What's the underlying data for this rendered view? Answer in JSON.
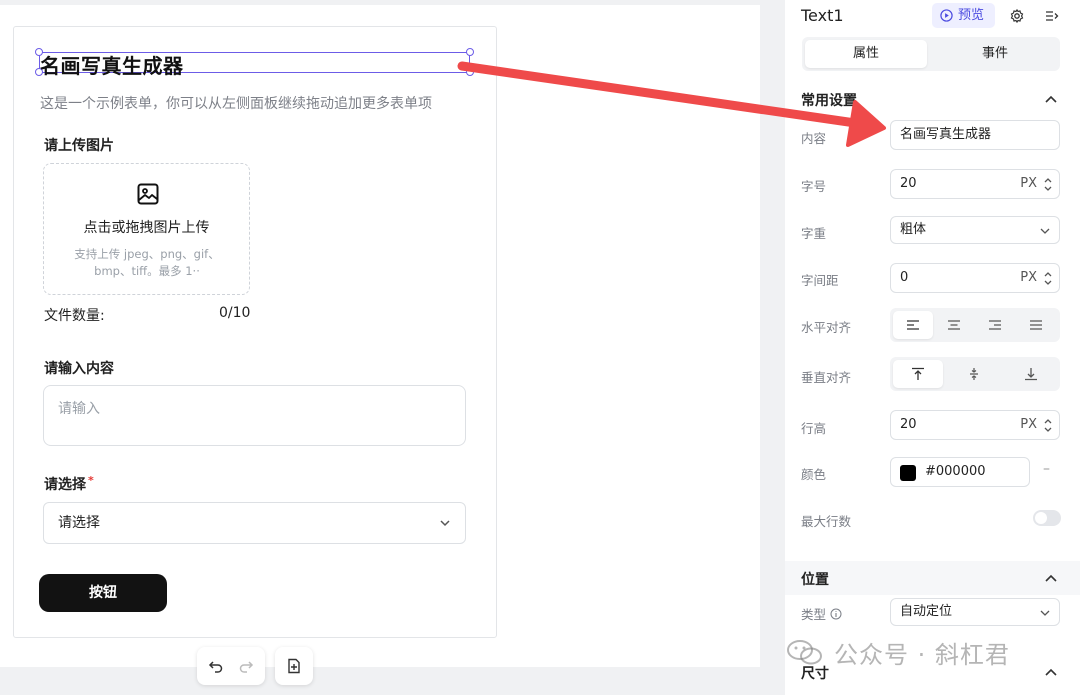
{
  "canvas": {
    "form_title": "名画写真生成器",
    "form_desc": "这是一个示例表单，你可以从左侧面板继续拖动追加更多表单项",
    "upload": {
      "label": "请上传图片",
      "main_text": "点击或拖拽图片上传",
      "sub_text": "支持上传 jpeg、png、gif、bmp、tiff。最多 1··"
    },
    "file_count": {
      "label": "文件数量:",
      "value": "0/10"
    },
    "textarea": {
      "label": "请输入内容",
      "placeholder": "请输入"
    },
    "select": {
      "label": "请选择",
      "required_mark": "*",
      "value": "请选择"
    },
    "button_label": "按钮"
  },
  "panel": {
    "title": "Text1",
    "preview_label": "预览",
    "tabs": [
      {
        "label": "属性",
        "active": true
      },
      {
        "label": "事件",
        "active": false
      }
    ],
    "section_common": "常用设置",
    "rows": {
      "content": {
        "label": "内容",
        "value": "名画写真生成器"
      },
      "font_size": {
        "label": "字号",
        "value": "20",
        "unit": "PX"
      },
      "font_weight": {
        "label": "字重",
        "value": "粗体"
      },
      "letter_spacing": {
        "label": "字间距",
        "value": "0",
        "unit": "PX"
      },
      "h_align": {
        "label": "水平对齐"
      },
      "v_align": {
        "label": "垂直对齐"
      },
      "line_height": {
        "label": "行高",
        "value": "20",
        "unit": "PX"
      },
      "color": {
        "label": "颜色",
        "value": "#000000"
      },
      "max_lines": {
        "label": "最大行数"
      }
    },
    "section_position": "位置",
    "position_type": {
      "label": "类型",
      "value": "自动定位"
    },
    "section_size": "尺寸"
  },
  "watermark": "公众号 · 斜杠君",
  "colors": {
    "accent": "#4b4be0",
    "selection": "#6c5ce7",
    "arrow": "#ef4a4a",
    "button": "#121212"
  }
}
